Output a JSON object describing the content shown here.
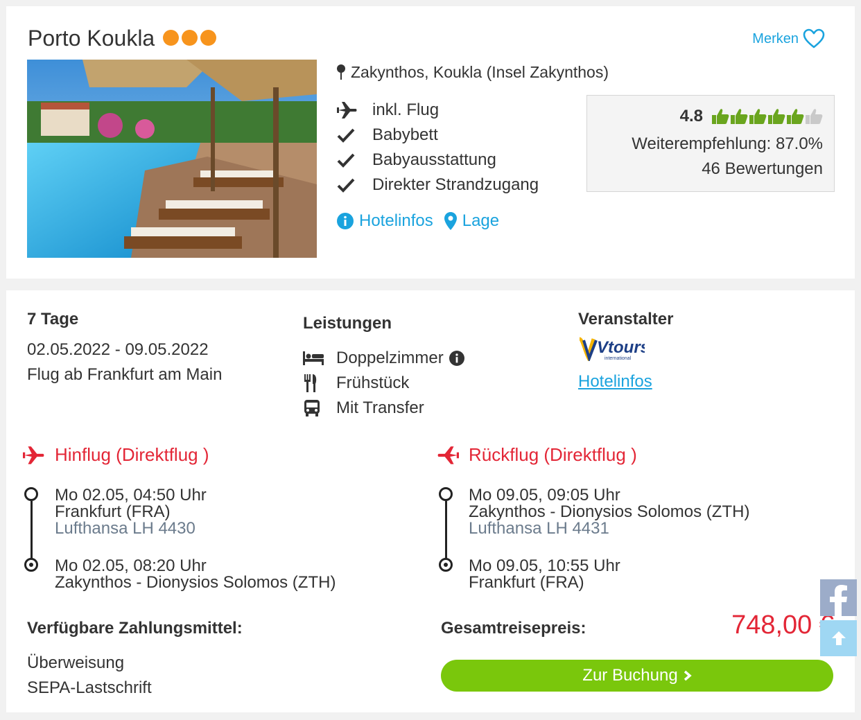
{
  "hotel": {
    "name": "Porto Koukla",
    "stars": 3,
    "location": "Zakynthos, Koukla (Insel Zakynthos)",
    "features": [
      "inkl. Flug",
      "Babybett",
      "Babyausstattung",
      "Direkter Strandzugang"
    ],
    "link_hotelinfos": "Hotelinfos",
    "link_lage": "Lage",
    "merken_label": "Merken"
  },
  "rating": {
    "score": "4.8",
    "thumbs_filled": 5,
    "thumbs_total": 6,
    "recommendation": "Weiterempfehlung: 87.0%",
    "reviews": "46 Bewertungen"
  },
  "offer": {
    "duration": "7 Tage",
    "dates": "02.05.2022 - 09.05.2022",
    "departure": "Flug ab Frankfurt am Main",
    "services_title": "Leistungen",
    "services": [
      "Doppelzimmer",
      "Frühstück",
      "Mit Transfer"
    ],
    "operator_title": "Veranstalter",
    "operator_logo_text": "Vtours",
    "operator_logo_sub": "international",
    "operator_link": "Hotelinfos"
  },
  "outbound": {
    "title": "Hinflug (Direktflug )",
    "dep_time": "Mo 02.05, 04:50 Uhr",
    "dep_airport": "Frankfurt (FRA)",
    "airline": "Lufthansa LH 4430",
    "arr_time": "Mo 02.05, 08:20 Uhr",
    "arr_airport": "Zakynthos - Dionysios Solomos (ZTH)"
  },
  "return": {
    "title": "Rückflug (Direktflug )",
    "dep_time": "Mo 09.05, 09:05 Uhr",
    "dep_airport": "Zakynthos - Dionysios Solomos (ZTH)",
    "airline": "Lufthansa LH 4431",
    "arr_time": "Mo 09.05, 10:55 Uhr",
    "arr_airport": "Frankfurt (FRA)"
  },
  "payment": {
    "title": "Verfügbare Zahlungsmittel:",
    "methods": [
      "Überweisung",
      "SEPA-Lastschrift"
    ]
  },
  "price": {
    "label": "Gesamtreisepreis:",
    "value": "748,00 €",
    "book_label": "Zur Buchung"
  },
  "colors": {
    "accent_blue": "#1aa3de",
    "price_red": "#e32636",
    "book_green": "#7ac70c",
    "star_orange": "#f7941d",
    "thumb_green": "#6aa51e"
  }
}
